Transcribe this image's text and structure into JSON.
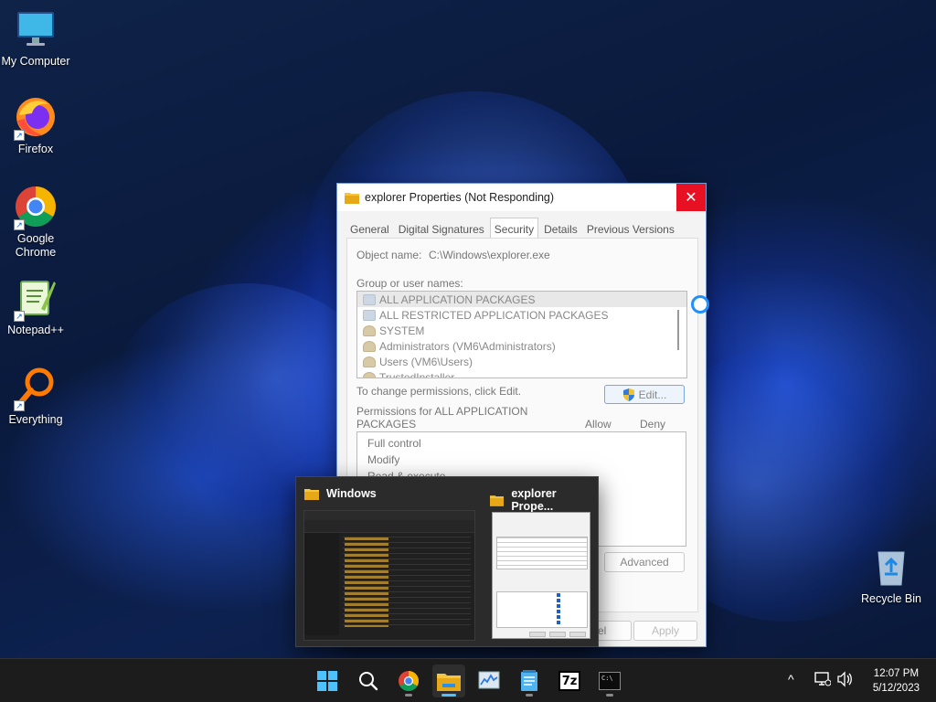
{
  "desktop": {
    "icons": [
      {
        "label": "My Computer"
      },
      {
        "label": "Firefox"
      },
      {
        "label": "Google Chrome"
      },
      {
        "label": "Notepad++"
      },
      {
        "label": "Everything"
      },
      {
        "label": "Recycle Bin"
      }
    ]
  },
  "props_window": {
    "title": "explorer Properties (Not Responding)",
    "close_glyph": "✕",
    "tabs": [
      "General",
      "Digital Signatures",
      "Security",
      "Details",
      "Previous Versions"
    ],
    "active_tab": "Security",
    "object_name_label": "Object name:",
    "object_name_value": "C:\\Windows\\explorer.exe",
    "group_label": "Group or user names:",
    "groups": [
      "ALL APPLICATION PACKAGES",
      "ALL RESTRICTED APPLICATION PACKAGES",
      "SYSTEM",
      "Administrators (VM6\\Administrators)",
      "Users (VM6\\Users)",
      "TrustedInstaller"
    ],
    "change_text": "To change permissions, click Edit.",
    "edit_button": "Edit...",
    "permissions_label": "Permissions for ALL APPLICATION PACKAGES",
    "allow_header": "Allow",
    "deny_header": "Deny",
    "permissions": [
      "Full control",
      "Modify",
      "Read & execute"
    ],
    "advanced_button": "Advanced",
    "cancel_button_partial": "el",
    "apply_button": "Apply"
  },
  "preview": {
    "items": [
      {
        "title": "Windows",
        "icon": "folder-icon"
      },
      {
        "title": "explorer Prope...",
        "icon": "folder-icon"
      }
    ]
  },
  "taskbar": {
    "apps": [
      "start-icon",
      "search-icon",
      "chrome-icon",
      "file-explorer-icon",
      "resource-monitor-icon",
      "notepad-icon",
      "7zip-icon",
      "terminal-icon"
    ],
    "seven_zip_label": "7z",
    "terminal_label": "C:\\",
    "tray_chevron": "^",
    "clock_time": "12:07 PM",
    "clock_date": "5/12/2023"
  },
  "colors": {
    "accent": "#4cc2ff",
    "close_red": "#e81123",
    "folder_yellow": "#f5c542"
  }
}
